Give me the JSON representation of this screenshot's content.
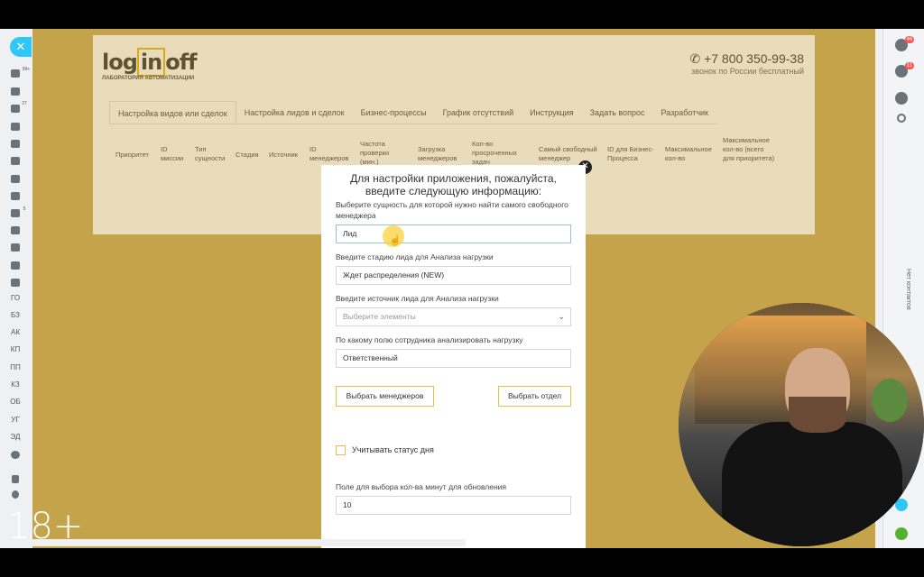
{
  "left_sidebar": {
    "close_glyph": "✕",
    "count_label": "99+",
    "badge_label": "27",
    "badge2_label": "5",
    "items": [
      "ГО",
      "БЗ",
      "АК",
      "КП",
      "ПП",
      "КЗ",
      "ОБ",
      "УГ",
      "ЭД"
    ]
  },
  "app": {
    "logo": {
      "log": "log",
      "in": "in",
      "off": "off",
      "subtitle": "ЛАБОРАТОРИЯ АВТОМАТИЗАЦИИ"
    },
    "phone": "+7 800 350-99-38",
    "phone_note": "звонок по России бесплатный",
    "tabs": [
      "Настройка видов или сделок",
      "Настройка лидов и сделок",
      "Бизнес-процессы",
      "График отсутствий",
      "Инструкция",
      "Задать вопрос",
      "Разработчик"
    ],
    "columns": [
      "Приоритет",
      "ID миссии",
      "Тип сущности",
      "Стадия",
      "Источник",
      "ID менеджеров",
      "Частота проверки (мин.)",
      "Загрузка менеджеров",
      "Кол-во просроченных задач",
      "Самый свободный менеджер",
      "ID для Бизнес-Процесса",
      "Максимальное кол-во",
      "Максимальное кол-во (всего для приоритета)"
    ]
  },
  "modal": {
    "close_glyph": "✕",
    "title": "Для настройки приложения, пожалуйста, введите следующую информацию:",
    "entity_label": "Выберите сущность для которой нужно найти самого свободного менеджера",
    "entity_value": "Лид",
    "stage_label": "Введите стадию лида для Анализа нагрузки",
    "stage_value": "Ждет распределения (NEW)",
    "source_label": "Введите источник лида для Анализа нагрузки",
    "source_placeholder": "Выберите элементы",
    "field_label": "По какому полю сотрудника анализировать нагрузку",
    "field_value": "Ответственный",
    "select_managers_button": "Выбрать менеджеров",
    "select_department_button": "Выбрать отдел",
    "day_status_label": "Учитывать статус дня",
    "day_status_checked": false,
    "minutes_label": "Поле для выбора кол-ва минут для обновления",
    "minutes_value": "10"
  },
  "right_bar": {
    "badge_1": "46",
    "badge_2": "11",
    "vertical_text": "Нет контактов"
  },
  "overlay": {
    "age_rating": "18+"
  },
  "colors": {
    "accent": "#e3c24c",
    "sidebar_close": "#2fc7f7",
    "background": "#c5a34a"
  }
}
